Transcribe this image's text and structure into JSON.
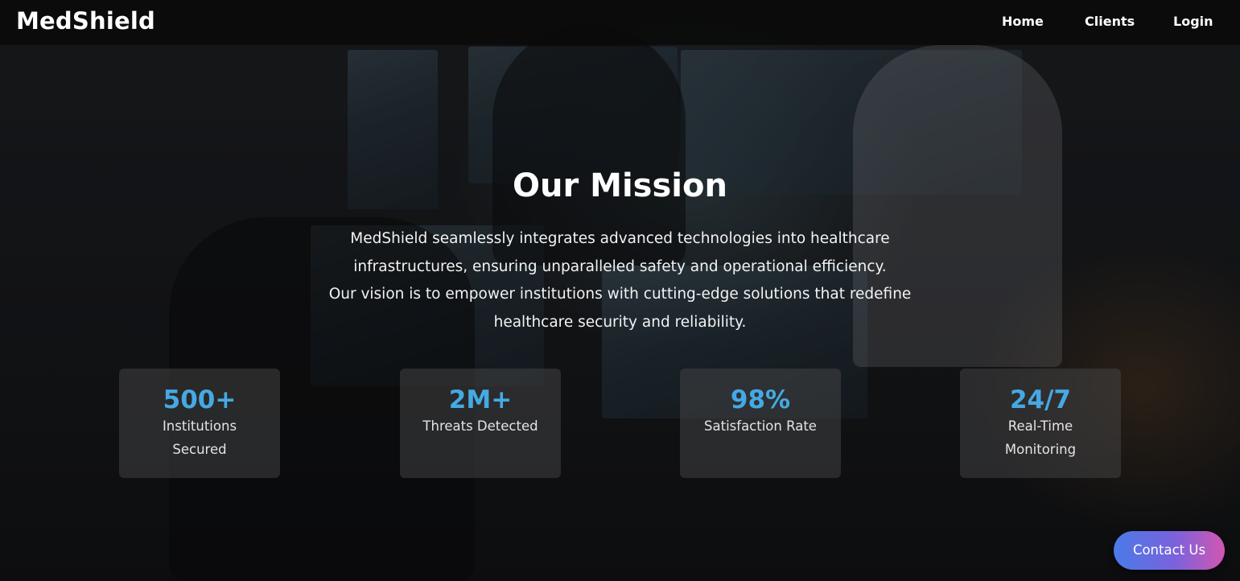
{
  "navbar": {
    "brand": "MedShield",
    "links": [
      "Home",
      "Clients",
      "Login"
    ]
  },
  "mission": {
    "title": "Our Mission",
    "lines": [
      "MedShield seamlessly integrates advanced technologies into healthcare",
      "infrastructures, ensuring unparalleled safety and operational efficiency.",
      "Our vision is to empower institutions with cutting-edge solutions that redefine",
      "healthcare security and reliability."
    ]
  },
  "stats": [
    {
      "value": "500+",
      "label": "Institutions Secured"
    },
    {
      "value": "2M+",
      "label": "Threats Detected"
    },
    {
      "value": "98%",
      "label": "Satisfaction Rate"
    },
    {
      "value": "24/7",
      "label": "Real-Time Monitoring"
    }
  ],
  "contact_button": {
    "label": "Contact Us"
  },
  "colors": {
    "accent": "#45a9e3",
    "contact_gradient_start": "#4a7be8",
    "contact_gradient_end": "#d257b0"
  }
}
